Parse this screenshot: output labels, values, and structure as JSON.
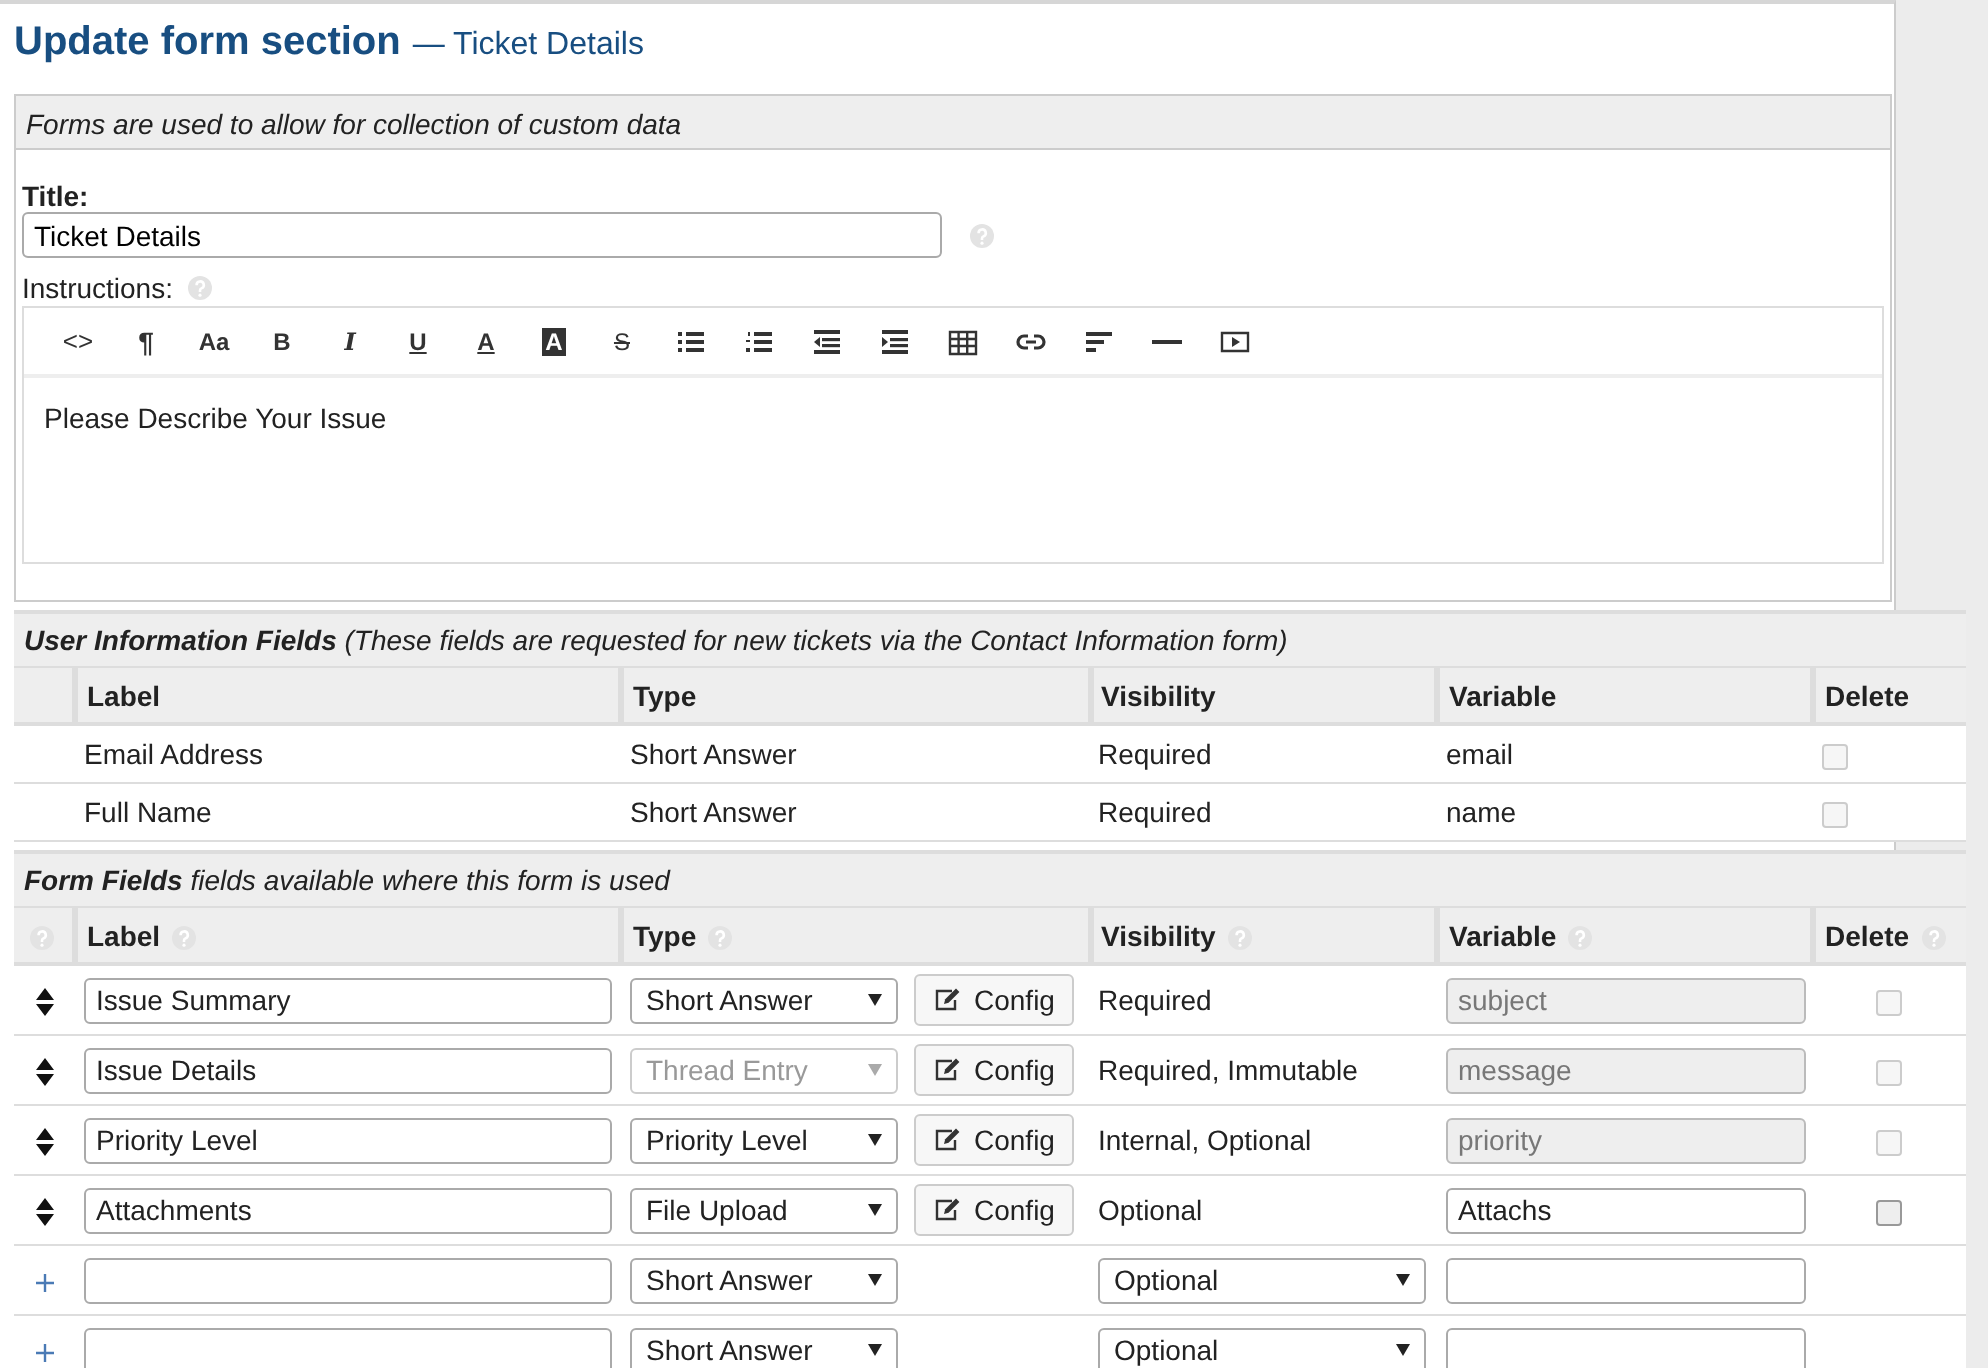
{
  "heading": {
    "title": "Update form section",
    "subtitle": "— Ticket Details"
  },
  "form": {
    "notice": "Forms are used to allow for collection of custom data",
    "title_label": "Title:",
    "title_value": "Ticket Details",
    "instructions_label": "Instructions:",
    "toolbar": [
      {
        "kind": "code",
        "glyph": "<>"
      },
      {
        "kind": "paragraph",
        "glyph": "¶"
      },
      {
        "kind": "size",
        "glyph": "Aa"
      },
      {
        "kind": "bold",
        "glyph": "B"
      },
      {
        "kind": "italic",
        "glyph": "I"
      },
      {
        "kind": "underline",
        "glyph": "U"
      },
      {
        "kind": "color",
        "glyph": "A"
      },
      {
        "kind": "highlight",
        "glyph": "A"
      },
      {
        "kind": "strike",
        "glyph": "S"
      },
      {
        "kind": "bullets"
      },
      {
        "kind": "numbers"
      },
      {
        "kind": "outdent"
      },
      {
        "kind": "indent"
      },
      {
        "kind": "table"
      },
      {
        "kind": "link"
      },
      {
        "kind": "align"
      },
      {
        "kind": "rule"
      },
      {
        "kind": "video"
      }
    ],
    "instructions_text": "Please Describe Your Issue"
  },
  "user_fields": {
    "caption": "**User Information Fields** (These fields are requested for new tickets via the Contact Information form)",
    "columns": [
      "Label",
      "Type",
      "Visibility",
      "Variable",
      "Delete"
    ],
    "rows": [
      {
        "label": "Email Address",
        "type": "Short Answer",
        "visibility": "Required",
        "variable": "email",
        "delete_checked": false,
        "delete_disabled": true
      },
      {
        "label": "Full Name",
        "type": "Short Answer",
        "visibility": "Required",
        "variable": "name",
        "delete_checked": false,
        "delete_disabled": true
      }
    ]
  },
  "form_fields": {
    "caption": "**Form Fields** fields available where this form is used",
    "columns": [
      "Label",
      "Type",
      "Visibility",
      "Variable",
      "Delete"
    ],
    "rows": [
      {
        "kind": "existing",
        "label": "Issue Summary",
        "type": "Short Answer",
        "type_disabled": false,
        "config": "Config",
        "visibility": "Required",
        "variable": "subject",
        "variable_disabled": true,
        "delete_checked": false,
        "delete_disabled": true
      },
      {
        "kind": "existing",
        "label": "Issue Details",
        "type": "Thread Entry",
        "type_disabled": true,
        "config": "Config",
        "visibility": "Required, Immutable",
        "variable": "message",
        "variable_disabled": true,
        "delete_checked": false,
        "delete_disabled": true
      },
      {
        "kind": "existing",
        "label": "Priority Level",
        "type": "Priority Level",
        "type_disabled": false,
        "config": "Config",
        "visibility": "Internal, Optional",
        "variable": "priority",
        "variable_disabled": true,
        "delete_checked": false,
        "delete_disabled": true
      },
      {
        "kind": "existing",
        "label": "Attachments",
        "type": "File Upload",
        "type_disabled": false,
        "config": "Config",
        "visibility": "Optional",
        "variable": "Attachs",
        "variable_disabled": false,
        "delete_checked": false,
        "delete_disabled": false
      },
      {
        "kind": "new",
        "type": "Short Answer",
        "visibility": "Optional"
      },
      {
        "kind": "new",
        "type": "Short Answer",
        "visibility": "Optional"
      }
    ]
  }
}
